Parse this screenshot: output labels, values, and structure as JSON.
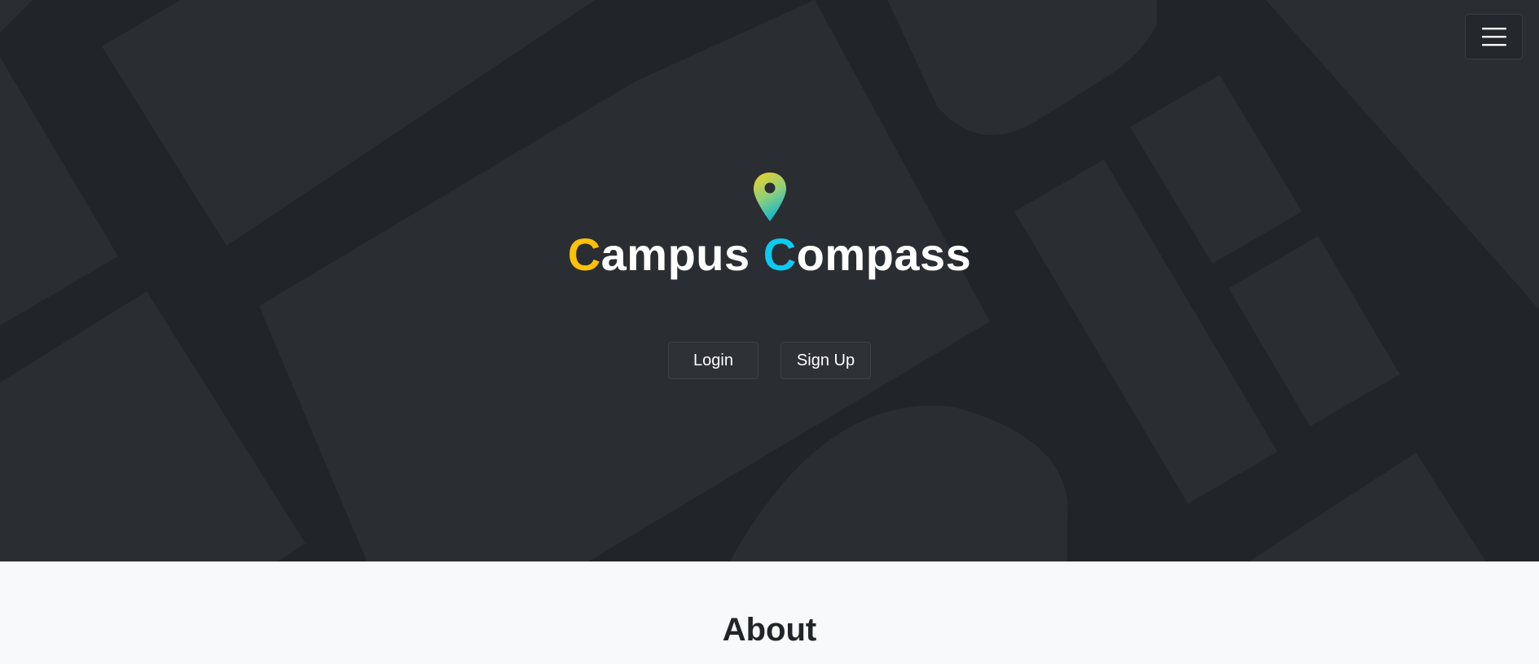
{
  "app": {
    "title_parts": {
      "first_initial": "C",
      "first_rest": "ampus",
      "second_initial": "C",
      "second_rest": "ompass"
    },
    "logo_icon": "map-pin-icon",
    "colors": {
      "hero_background": "#212428",
      "map_block": "#2a2d32",
      "first_initial": "#ffc107",
      "second_initial": "#0dcaf0",
      "about_background": "#f8f9fa"
    }
  },
  "nav": {
    "menu_icon": "hamburger-menu-icon"
  },
  "hero": {
    "login_label": "Login",
    "signup_label": "Sign Up"
  },
  "about": {
    "heading": "About"
  }
}
